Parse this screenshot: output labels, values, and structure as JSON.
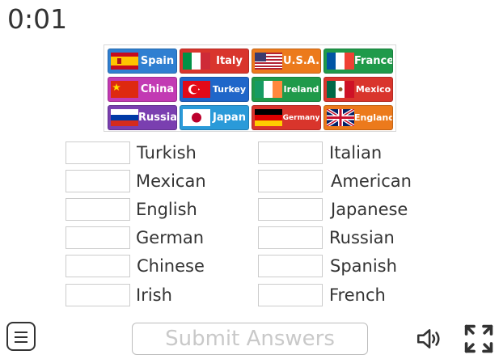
{
  "timer": "0:01",
  "tiles": [
    {
      "label": "Spain",
      "color": "#2f7fd1",
      "flag": "spain"
    },
    {
      "label": "Italy",
      "color": "#d9352c",
      "flag": "italy"
    },
    {
      "label": "U.S.A.",
      "color": "#ec7a1c",
      "flag": "usa"
    },
    {
      "label": "France",
      "color": "#1f9a4a",
      "flag": "france"
    },
    {
      "label": "China",
      "color": "#c23ab3",
      "flag": "china"
    },
    {
      "label": "Turkey",
      "color": "#1f66c9",
      "flag": "turkey"
    },
    {
      "label": "Ireland",
      "color": "#1f9a4a",
      "flag": "ireland"
    },
    {
      "label": "Mexico",
      "color": "#d9352c",
      "flag": "mexico"
    },
    {
      "label": "Russia",
      "color": "#7a3fb0",
      "flag": "russia"
    },
    {
      "label": "Japan",
      "color": "#2a9ad9",
      "flag": "japan"
    },
    {
      "label": "Germany",
      "color": "#d9352c",
      "flag": "germany"
    },
    {
      "label": "England",
      "color": "#ec7a1c",
      "flag": "uk"
    }
  ],
  "rows_left": [
    "Turkish",
    "Mexican",
    "English",
    "German",
    "Chinese",
    "Irish"
  ],
  "rows_right": [
    "Italian",
    "American",
    "Japanese",
    "Russian",
    "Spanish",
    "French"
  ],
  "submit_label": "Submit Answers",
  "icons": {
    "menu": "menu-icon",
    "sound": "speaker-icon",
    "fullscreen": "fullscreen-icon"
  }
}
